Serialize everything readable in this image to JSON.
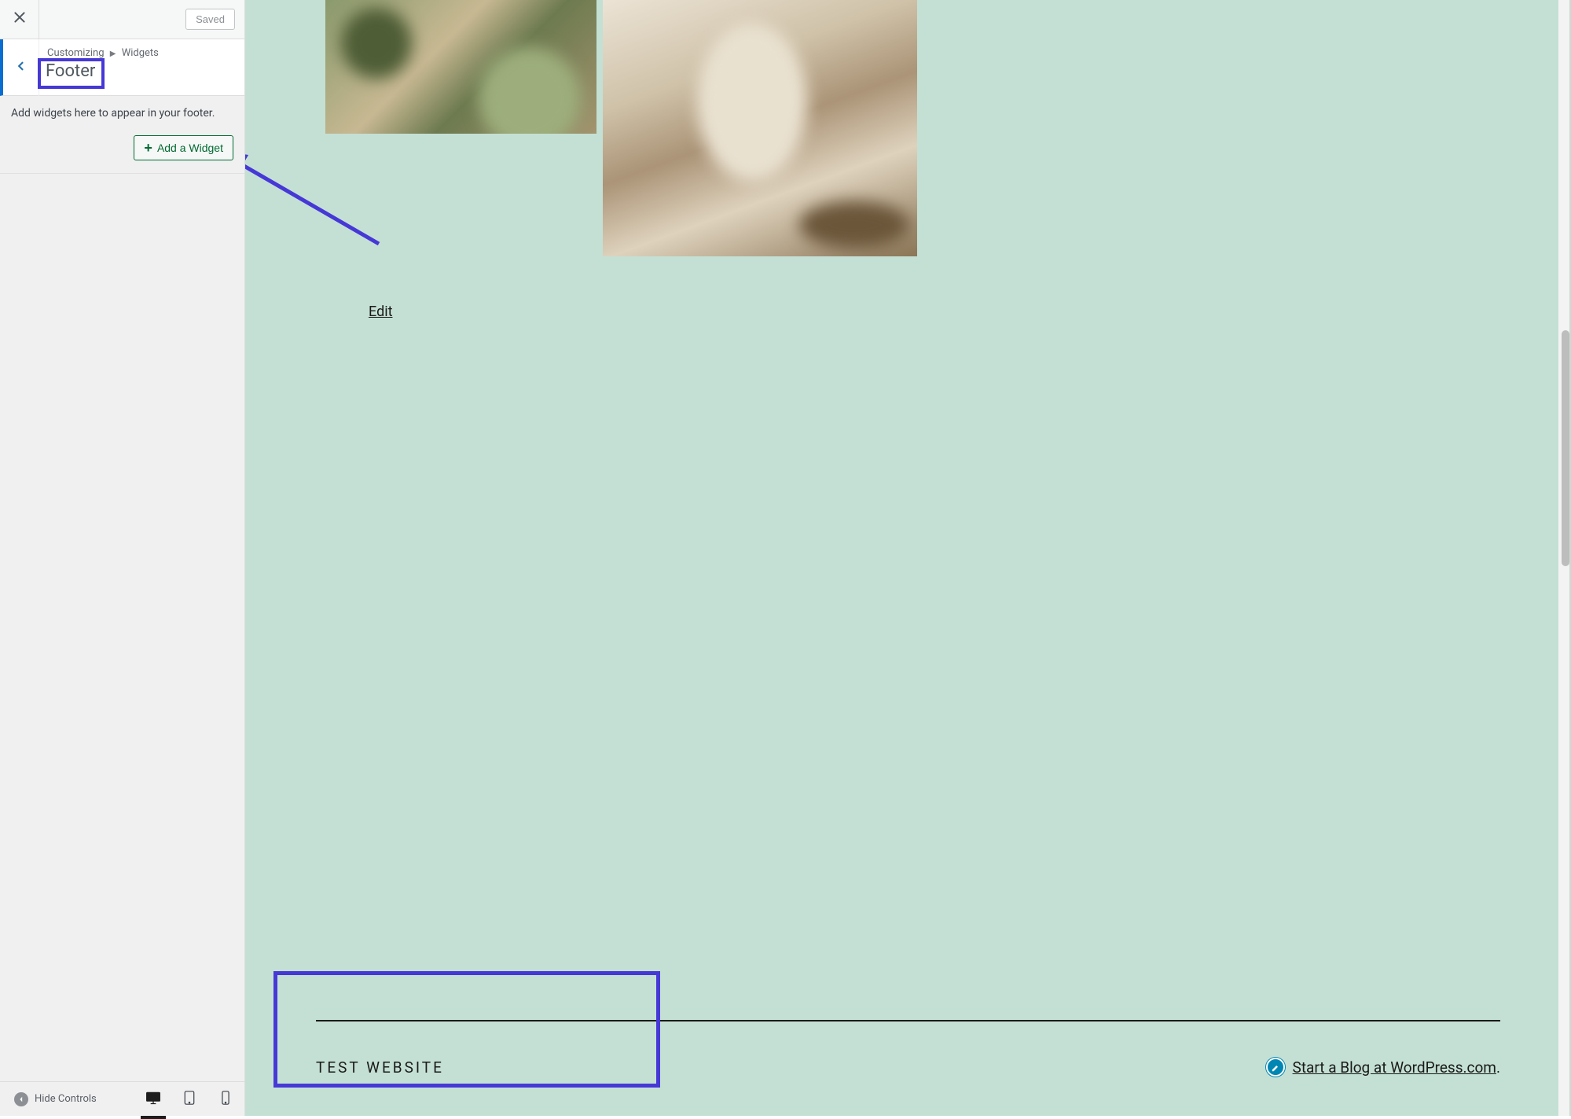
{
  "colors": {
    "accent": "#4638d6",
    "wp_blue": "#0a6ed1",
    "preview_bg": "#c4e0d4",
    "add_widget_green": "#006b31"
  },
  "sidebar": {
    "saved_label": "Saved",
    "breadcrumb": {
      "part1": "Customizing",
      "part2": "Widgets"
    },
    "section_title": "Footer",
    "description": "Add widgets here to appear in your footer.",
    "add_widget_label": "Add a Widget",
    "hide_controls_label": "Hide Controls"
  },
  "preview": {
    "edit_label": "Edit",
    "site_name": "TEST WEBSITE",
    "footer_link_text": "Start a Blog at WordPress.com",
    "footer_link_suffix": "."
  }
}
